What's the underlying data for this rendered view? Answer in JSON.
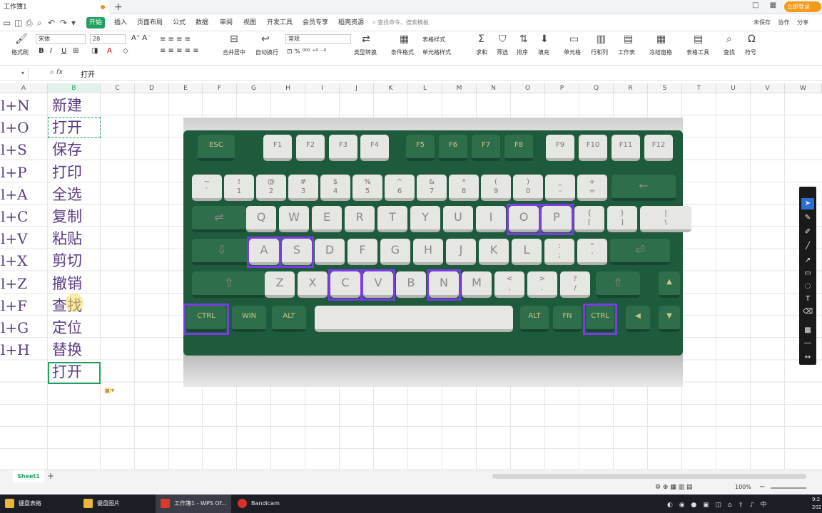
{
  "window": {
    "doc_tab": "工作簿1",
    "vip_button": "立即登录"
  },
  "menu": {
    "items": [
      "开始",
      "插入",
      "页面布局",
      "公式",
      "数据",
      "审阅",
      "视图",
      "开发工具",
      "会员专享",
      "稻壳资源"
    ],
    "active": "开始",
    "search_placeholder": "查找命令、搜索模板",
    "unsaved": "未保存",
    "collab": "协作",
    "share": "分享"
  },
  "ribbon": {
    "format_painter": "格式刷",
    "font_name": "宋体",
    "font_size": "28",
    "merge_center": "合并居中",
    "wrap_text": "自动换行",
    "number_format": "常规",
    "type_convert": "类型转换",
    "conditional_format": "条件格式",
    "table_style": "表格样式",
    "cell_style": "单元格样式",
    "sum": "求和",
    "filter": "筛选",
    "sort": "排序",
    "fill": "填充",
    "cell": "单元格",
    "row_col": "行和列",
    "worksheet": "工作表",
    "freeze": "冻结窗格",
    "table_tools": "表格工具",
    "find": "查找",
    "symbol": "符号"
  },
  "formula_bar": {
    "fx": "fx",
    "value": "打开"
  },
  "columns": [
    "A",
    "B",
    "C",
    "D",
    "E",
    "F",
    "G",
    "H",
    "I",
    "J",
    "K",
    "L",
    "M",
    "N",
    "O",
    "P",
    "Q",
    "R",
    "S",
    "T",
    "U",
    "V",
    "W"
  ],
  "selected_column": "B",
  "rows": [
    {
      "a": "l+N",
      "b": "新建"
    },
    {
      "a": "l+O",
      "b": "打开"
    },
    {
      "a": "l+S",
      "b": "保存"
    },
    {
      "a": "l+P",
      "b": "打印"
    },
    {
      "a": "l+A",
      "b": "全选"
    },
    {
      "a": "l+C",
      "b": "复制"
    },
    {
      "a": "l+V",
      "b": "粘贴"
    },
    {
      "a": "l+X",
      "b": "剪切"
    },
    {
      "a": "l+Z",
      "b": "撤销"
    },
    {
      "a": "l+F",
      "b": "查找"
    },
    {
      "a": "l+G",
      "b": "定位"
    },
    {
      "a": "l+H",
      "b": "替换"
    },
    {
      "a": "",
      "b": "打开"
    }
  ],
  "keyboard": {
    "row_f": [
      "ESC",
      "F1",
      "F2",
      "F3",
      "F4",
      "F5",
      "F6",
      "F7",
      "F8",
      "F9",
      "F10",
      "F11",
      "F12"
    ],
    "row_num": [
      "~\n`",
      "!\n1",
      "@\n2",
      "#\n3",
      "$\n4",
      "%\n5",
      "^\n6",
      "&\n7",
      "*\n8",
      "(\n9",
      ")\n0",
      "_\n-",
      "+\n="
    ],
    "row_q": [
      "Q",
      "W",
      "E",
      "R",
      "T",
      "Y",
      "U",
      "I",
      "O",
      "P",
      "{\n[",
      "}\n]",
      "|\n\\"
    ],
    "row_a": [
      "A",
      "S",
      "D",
      "F",
      "G",
      "H",
      "J",
      "K",
      "L",
      ":\n;",
      "\"\n'"
    ],
    "row_z": [
      "Z",
      "X",
      "C",
      "V",
      "B",
      "N",
      "M",
      "<\n,",
      ">\n.",
      "?\n/"
    ],
    "row_bottom": [
      "CTRL",
      "WIN",
      "ALT",
      "ALT",
      "FN",
      "CTRL"
    ],
    "highlighted": [
      "O",
      "P",
      "A",
      "S",
      "C",
      "V",
      "N",
      "CTRL",
      "CTRL"
    ]
  },
  "sheet": {
    "tab": "Sheet1",
    "zoom": "100%"
  },
  "taskbar": {
    "items": [
      "键盘表格",
      "键盘图片",
      "工作簿1 - WPS Of...",
      "Bandicam"
    ],
    "tray": "中",
    "clock": "9:2\n202"
  },
  "colors": {
    "accent": "#20a162",
    "highlight": "#7b3be6",
    "cell_text": "#5a3b82",
    "keyboard_case": "#1e5a3c"
  }
}
